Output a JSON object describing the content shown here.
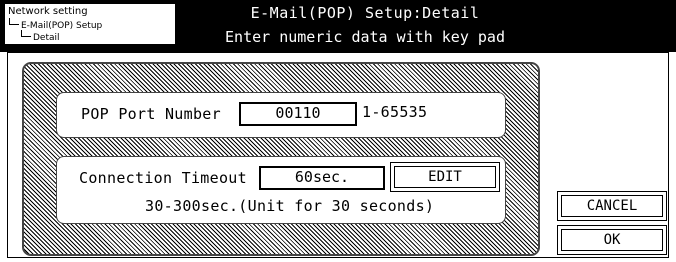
{
  "header": {
    "breadcrumb": [
      "Network setting",
      "E-Mail(POP) Setup",
      "Detail"
    ],
    "title": "E-Mail(POP) Setup:Detail",
    "subtitle": "Enter numeric data with key pad"
  },
  "pop_port": {
    "label": "POP Port Number",
    "value": "00110",
    "range": "1-65535"
  },
  "timeout": {
    "label": "Connection Timeout",
    "value": "60sec.",
    "edit_label": "EDIT",
    "hint": "30-300sec.(Unit for 30 seconds)"
  },
  "buttons": {
    "cancel": "CANCEL",
    "ok": "OK"
  }
}
